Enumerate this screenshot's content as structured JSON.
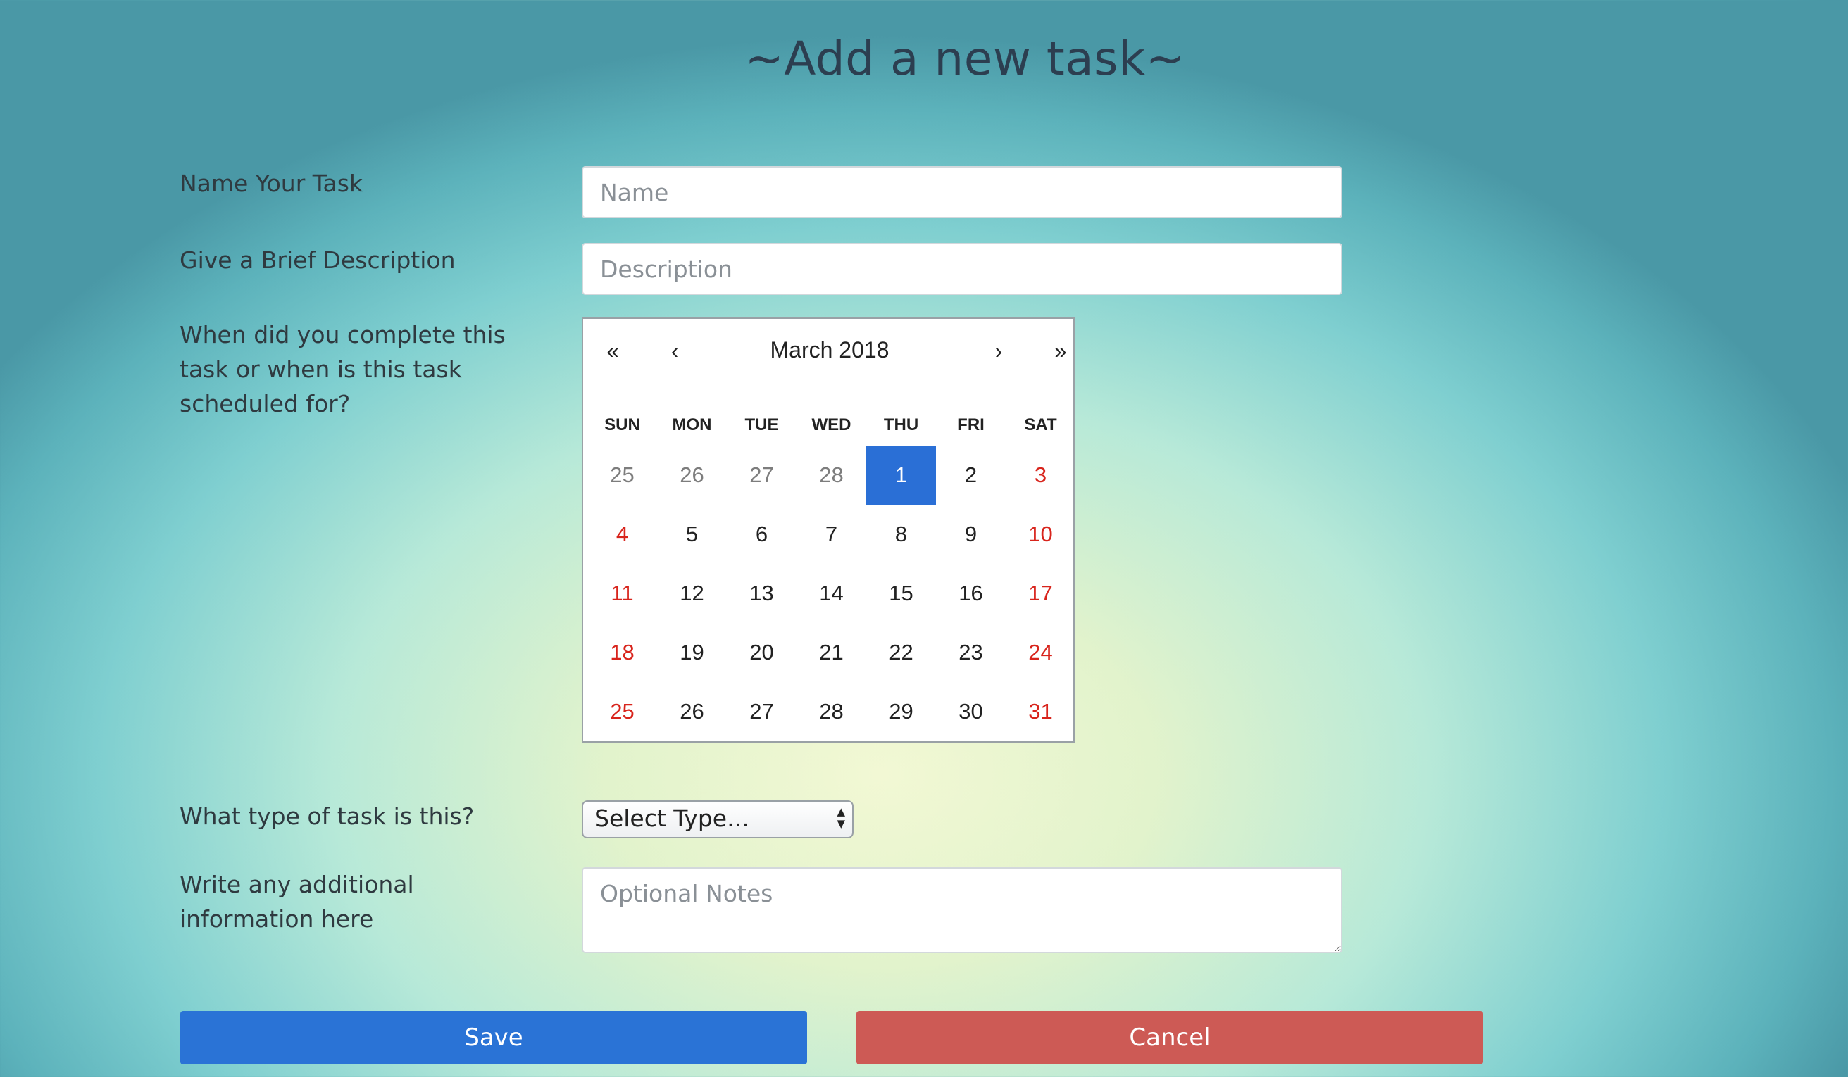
{
  "page": {
    "title": "~Add a new task~"
  },
  "form": {
    "name_label": "Name Your Task",
    "name_placeholder": "Name",
    "desc_label": "Give a Brief Description",
    "desc_placeholder": "Description",
    "date_label": "When did you complete this task or when is this task scheduled for?",
    "type_label": "What type of task is this?",
    "type_selected": "Select Type...",
    "notes_label": "Write any additional information here",
    "notes_placeholder": "Optional Notes"
  },
  "calendar": {
    "month_label": "March 2018",
    "prev_year": "«",
    "prev_month": "‹",
    "next_month": "›",
    "next_year": "»",
    "weekdays": [
      "SUN",
      "MON",
      "TUE",
      "WED",
      "THU",
      "FRI",
      "SAT"
    ],
    "days": [
      {
        "n": "25",
        "s": "muted"
      },
      {
        "n": "26",
        "s": "muted"
      },
      {
        "n": "27",
        "s": "muted"
      },
      {
        "n": "28",
        "s": "muted"
      },
      {
        "n": "1",
        "s": "selected"
      },
      {
        "n": "2",
        "s": ""
      },
      {
        "n": "3",
        "s": "weekend"
      },
      {
        "n": "4",
        "s": "weekend"
      },
      {
        "n": "5",
        "s": ""
      },
      {
        "n": "6",
        "s": ""
      },
      {
        "n": "7",
        "s": ""
      },
      {
        "n": "8",
        "s": ""
      },
      {
        "n": "9",
        "s": ""
      },
      {
        "n": "10",
        "s": "weekend"
      },
      {
        "n": "11",
        "s": "weekend"
      },
      {
        "n": "12",
        "s": ""
      },
      {
        "n": "13",
        "s": ""
      },
      {
        "n": "14",
        "s": ""
      },
      {
        "n": "15",
        "s": ""
      },
      {
        "n": "16",
        "s": ""
      },
      {
        "n": "17",
        "s": "weekend"
      },
      {
        "n": "18",
        "s": "weekend"
      },
      {
        "n": "19",
        "s": ""
      },
      {
        "n": "20",
        "s": ""
      },
      {
        "n": "21",
        "s": ""
      },
      {
        "n": "22",
        "s": ""
      },
      {
        "n": "23",
        "s": ""
      },
      {
        "n": "24",
        "s": "weekend"
      },
      {
        "n": "25",
        "s": "weekend"
      },
      {
        "n": "26",
        "s": ""
      },
      {
        "n": "27",
        "s": ""
      },
      {
        "n": "28",
        "s": ""
      },
      {
        "n": "29",
        "s": ""
      },
      {
        "n": "30",
        "s": ""
      },
      {
        "n": "31",
        "s": "weekend"
      }
    ]
  },
  "buttons": {
    "save": "Save",
    "cancel": "Cancel"
  },
  "colors": {
    "save": "#2a73d6",
    "cancel": "#cd5a55",
    "selected_day": "#2a6fd6",
    "weekend": "#d8241c"
  }
}
